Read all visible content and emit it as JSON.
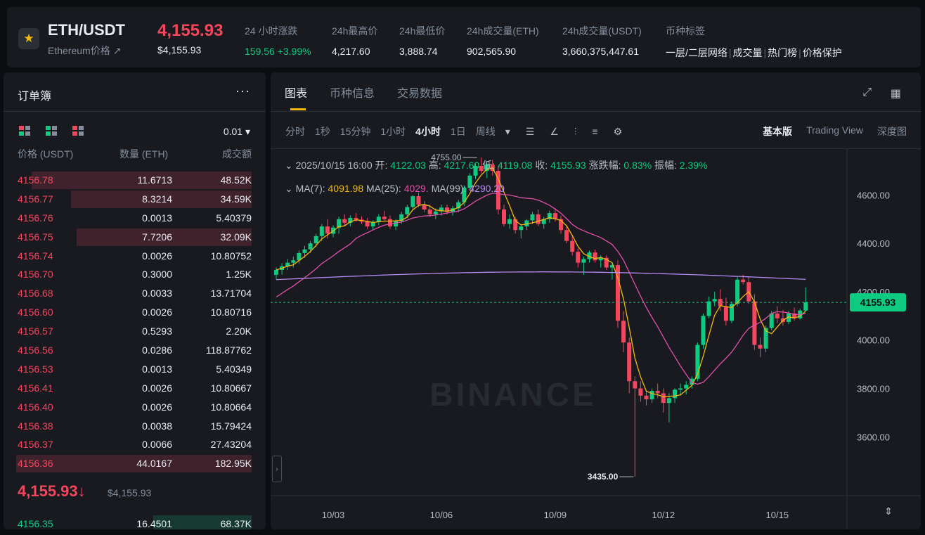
{
  "header": {
    "pair": "ETH/USDT",
    "subtitle": "Ethereum价格 ↗",
    "price": "4,155.93",
    "price_usd": "$4,155.93",
    "stats": [
      {
        "label": "24 小时涨跌",
        "value": "159.56 +3.99%",
        "color": "green"
      },
      {
        "label": "24h最高价",
        "value": "4,217.60"
      },
      {
        "label": "24h最低价",
        "value": "3,888.74"
      },
      {
        "label": "24h成交量(ETH)",
        "value": "902,565.90"
      },
      {
        "label": "24h成交量(USDT)",
        "value": "3,660,375,447.61"
      }
    ],
    "tags_label": "币种标签",
    "tags": [
      "一层/二层网络",
      "成交量",
      "热门榜",
      "价格保护"
    ],
    "colors": {
      "up": "#0ecb81",
      "down": "#f6465d",
      "brand": "#f0b90b"
    }
  },
  "orderbook": {
    "title": "订单簿",
    "more": "···",
    "precision": "0.01 ▾",
    "col_price": "价格 (USDT)",
    "col_qty": "数量 (ETH)",
    "col_total": "成交额",
    "asks": [
      {
        "price": "4156.78",
        "qty": "11.6713",
        "total": "48.52K",
        "depth": 0.89
      },
      {
        "price": "4156.77",
        "qty": "8.3214",
        "total": "34.59K",
        "depth": 0.61
      },
      {
        "price": "4156.76",
        "qty": "0.0013",
        "total": "5.40379",
        "depth": 0
      },
      {
        "price": "4156.75",
        "qty": "7.7206",
        "total": "32.09K",
        "depth": 0.57
      },
      {
        "price": "4156.74",
        "qty": "0.0026",
        "total": "10.80752",
        "depth": 0
      },
      {
        "price": "4156.70",
        "qty": "0.3000",
        "total": "1.25K",
        "depth": 0
      },
      {
        "price": "4156.68",
        "qty": "0.0033",
        "total": "13.71704",
        "depth": 0
      },
      {
        "price": "4156.60",
        "qty": "0.0026",
        "total": "10.80716",
        "depth": 0
      },
      {
        "price": "4156.57",
        "qty": "0.5293",
        "total": "2.20K",
        "depth": 0
      },
      {
        "price": "4156.56",
        "qty": "0.0286",
        "total": "118.87762",
        "depth": 0
      },
      {
        "price": "4156.53",
        "qty": "0.0013",
        "total": "5.40349",
        "depth": 0
      },
      {
        "price": "4156.41",
        "qty": "0.0026",
        "total": "10.80667",
        "depth": 0
      },
      {
        "price": "4156.40",
        "qty": "0.0026",
        "total": "10.80664",
        "depth": 0
      },
      {
        "price": "4156.38",
        "qty": "0.0038",
        "total": "15.79424",
        "depth": 0
      },
      {
        "price": "4156.37",
        "qty": "0.0066",
        "total": "27.43204",
        "depth": 0
      },
      {
        "price": "4156.36",
        "qty": "44.0167",
        "total": "182.95K",
        "depth": 1.0
      }
    ],
    "last_price": "4,155.93↓",
    "last_price_usd": "$4,155.93",
    "bid": {
      "price": "4156.35",
      "qty": "16.4501",
      "total": "68.37K",
      "depth": 0.4
    }
  },
  "chart_panel": {
    "tabs": [
      "图表",
      "币种信息",
      "交易数据"
    ],
    "intervals": [
      "分时",
      "1秒",
      "15分钟",
      "1小时",
      "4小时",
      "1日",
      "周线"
    ],
    "active_interval": "4小时",
    "view_modes": [
      "基本版",
      "Trading View",
      "深度图"
    ],
    "ohlc": {
      "date": "2025/10/15 16:00",
      "open_label": "开:",
      "open": "4122.03",
      "high_label": "高:",
      "high": "4217.60",
      "low_label": "低:",
      "low": "4119.08",
      "close_label": "收:",
      "close": "4155.93",
      "change_label": "涨跌幅:",
      "change": "0.83%",
      "amp_label": "振幅:",
      "amp": "2.39%"
    },
    "ma": {
      "ma7_label": "MA(7):",
      "ma7": "4091.98",
      "ma25_label": "MA(25):",
      "ma25": "4029.",
      "ma99_label": "MA(99):",
      "ma99": "4290.20"
    },
    "watermark": "BINANCE"
  },
  "chart_data": {
    "type": "candlestick",
    "y_ticks": [
      3600,
      3800,
      4000,
      4200,
      4400,
      4600
    ],
    "y_tick_labels": [
      "3600.00",
      "3800.00",
      "4000.00",
      "4200.00",
      "4400.00",
      "4600.00"
    ],
    "ylim": [
      3380,
      4790
    ],
    "x_labels": [
      "10/03",
      "10/06",
      "10/09",
      "10/12",
      "10/15"
    ],
    "last_price_label": "4155.93",
    "last_price": 4155.93,
    "high_annotation": {
      "label": "4755.00",
      "value": 4755.0
    },
    "low_annotation": {
      "label": "3435.00",
      "value": 3435.0
    },
    "ma_colors": {
      "ma7": "#f0b90b",
      "ma25": "#e04fa8",
      "ma99": "#b48cf2"
    },
    "candles": [
      [
        4270,
        4300,
        4252,
        4290
      ],
      [
        4290,
        4318,
        4270,
        4305
      ],
      [
        4305,
        4335,
        4290,
        4320
      ],
      [
        4320,
        4345,
        4300,
        4330
      ],
      [
        4330,
        4370,
        4315,
        4360
      ],
      [
        4360,
        4390,
        4340,
        4375
      ],
      [
        4375,
        4410,
        4360,
        4400
      ],
      [
        4400,
        4440,
        4385,
        4430
      ],
      [
        4430,
        4480,
        4410,
        4470
      ],
      [
        4470,
        4500,
        4420,
        4440
      ],
      [
        4440,
        4475,
        4425,
        4465
      ],
      [
        4465,
        4510,
        4440,
        4500
      ],
      [
        4500,
        4520,
        4470,
        4485
      ],
      [
        4485,
        4515,
        4470,
        4505
      ],
      [
        4505,
        4525,
        4490,
        4498
      ],
      [
        4498,
        4512,
        4480,
        4490
      ],
      [
        4490,
        4505,
        4460,
        4470
      ],
      [
        4470,
        4495,
        4455,
        4488
      ],
      [
        4488,
        4520,
        4475,
        4510
      ],
      [
        4510,
        4535,
        4495,
        4500
      ],
      [
        4500,
        4515,
        4460,
        4470
      ],
      [
        4470,
        4500,
        4455,
        4492
      ],
      [
        4492,
        4530,
        4480,
        4520
      ],
      [
        4520,
        4560,
        4505,
        4550
      ],
      [
        4550,
        4600,
        4535,
        4595
      ],
      [
        4595,
        4610,
        4550,
        4560
      ],
      [
        4560,
        4575,
        4530,
        4540
      ],
      [
        4540,
        4560,
        4510,
        4520
      ],
      [
        4520,
        4545,
        4500,
        4532
      ],
      [
        4532,
        4560,
        4515,
        4548
      ],
      [
        4548,
        4560,
        4520,
        4530
      ],
      [
        4530,
        4555,
        4515,
        4545
      ],
      [
        4545,
        4580,
        4530,
        4570
      ],
      [
        4570,
        4640,
        4555,
        4630
      ],
      [
        4630,
        4690,
        4620,
        4680
      ],
      [
        4680,
        4730,
        4665,
        4720
      ],
      [
        4720,
        4755,
        4690,
        4700
      ],
      [
        4700,
        4735,
        4670,
        4725
      ],
      [
        4725,
        4745,
        4680,
        4700
      ],
      [
        4700,
        4720,
        4520,
        4540
      ],
      [
        4540,
        4560,
        4470,
        4480
      ],
      [
        4480,
        4520,
        4460,
        4500
      ],
      [
        4500,
        4510,
        4440,
        4455
      ],
      [
        4455,
        4480,
        4420,
        4470
      ],
      [
        4470,
        4500,
        4455,
        4495
      ],
      [
        4495,
        4530,
        4480,
        4520
      ],
      [
        4520,
        4540,
        4470,
        4480
      ],
      [
        4480,
        4510,
        4460,
        4500
      ],
      [
        4500,
        4535,
        4485,
        4525
      ],
      [
        4525,
        4545,
        4490,
        4500
      ],
      [
        4500,
        4515,
        4440,
        4455
      ],
      [
        4455,
        4470,
        4400,
        4410
      ],
      [
        4410,
        4430,
        4350,
        4365
      ],
      [
        4365,
        4380,
        4300,
        4320
      ],
      [
        4320,
        4345,
        4270,
        4335
      ],
      [
        4335,
        4370,
        4320,
        4362
      ],
      [
        4362,
        4375,
        4320,
        4330
      ],
      [
        4330,
        4350,
        4300,
        4340
      ],
      [
        4340,
        4350,
        4290,
        4300
      ],
      [
        4300,
        4320,
        4250,
        4310
      ],
      [
        4310,
        4330,
        4050,
        4080
      ],
      [
        4080,
        4120,
        3950,
        3990
      ],
      [
        3990,
        4010,
        3780,
        3830
      ],
      [
        3830,
        3850,
        3435,
        3800
      ],
      [
        3800,
        3830,
        3745,
        3770
      ],
      [
        3770,
        3790,
        3730,
        3755
      ],
      [
        3755,
        3800,
        3740,
        3790
      ],
      [
        3790,
        3820,
        3760,
        3780
      ],
      [
        3780,
        3800,
        3700,
        3740
      ],
      [
        3740,
        3780,
        3660,
        3760
      ],
      [
        3760,
        3800,
        3740,
        3795
      ],
      [
        3795,
        3820,
        3770,
        3800
      ],
      [
        3800,
        3830,
        3775,
        3815
      ],
      [
        3815,
        3850,
        3800,
        3840
      ],
      [
        3840,
        3990,
        3830,
        3980
      ],
      [
        3980,
        4110,
        3965,
        4100
      ],
      [
        4100,
        4180,
        4090,
        4160
      ],
      [
        4160,
        4200,
        4140,
        4170
      ],
      [
        4170,
        4210,
        4120,
        4140
      ],
      [
        4140,
        4175,
        4060,
        4080
      ],
      [
        4080,
        4160,
        4070,
        4150
      ],
      [
        4150,
        4260,
        4140,
        4250
      ],
      [
        4250,
        4270,
        4230,
        4240
      ],
      [
        4240,
        4260,
        4150,
        4160
      ],
      [
        4160,
        4190,
        3960,
        3980
      ],
      [
        3980,
        4010,
        3930,
        3965
      ],
      [
        3965,
        4060,
        3950,
        4050
      ],
      [
        4050,
        4120,
        4040,
        4110
      ],
      [
        4110,
        4140,
        4070,
        4090
      ],
      [
        4090,
        4125,
        4060,
        4075
      ],
      [
        4075,
        4120,
        4065,
        4110
      ],
      [
        4110,
        4135,
        4080,
        4090
      ],
      [
        4090,
        4130,
        4085,
        4122
      ],
      [
        4122,
        4217.6,
        4119.08,
        4155.93
      ]
    ]
  }
}
